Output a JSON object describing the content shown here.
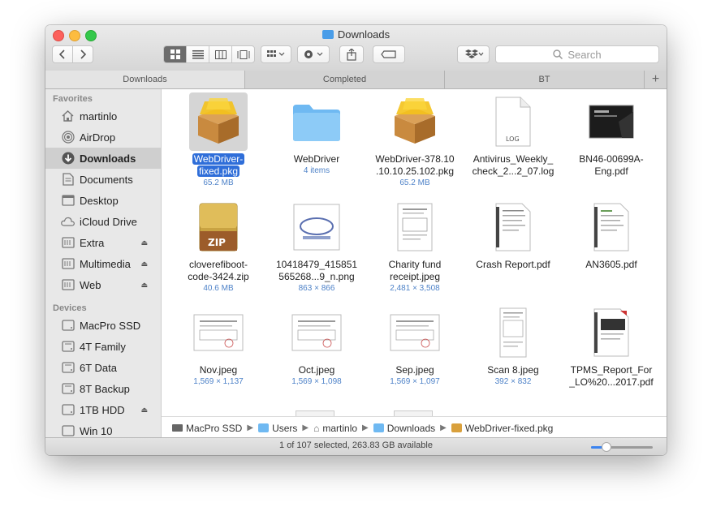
{
  "window": {
    "title": "Downloads"
  },
  "toolbar": {
    "search_placeholder": "Search"
  },
  "tabs": [
    {
      "label": "Downloads"
    },
    {
      "label": "Completed"
    },
    {
      "label": "BT"
    }
  ],
  "sidebar": {
    "favorites_header": "Favorites",
    "favorites": [
      {
        "label": "martinlo"
      },
      {
        "label": "AirDrop"
      },
      {
        "label": "Downloads"
      },
      {
        "label": "Documents"
      },
      {
        "label": "Desktop"
      },
      {
        "label": "iCloud Drive"
      },
      {
        "label": "Extra"
      },
      {
        "label": "Multimedia"
      },
      {
        "label": "Web"
      }
    ],
    "devices_header": "Devices",
    "devices": [
      {
        "label": "MacPro SSD"
      },
      {
        "label": "4T Family"
      },
      {
        "label": "6T Data"
      },
      {
        "label": "8T Backup"
      },
      {
        "label": "1TB HDD"
      },
      {
        "label": "Win 10"
      }
    ]
  },
  "files": [
    {
      "name": "WebDriver-fixed.pkg",
      "line1": "WebDriver-",
      "line2": "fixed.pkg",
      "meta": "65.2 MB"
    },
    {
      "name": "WebDriver",
      "line1": "WebDriver",
      "line2": "",
      "meta": "4 items"
    },
    {
      "name": "WebDriver-378.10.10.10.25.102.pkg",
      "line1": "WebDriver-378.10",
      "line2": ".10.10.25.102.pkg",
      "meta": "65.2 MB"
    },
    {
      "name": "Antivirus_Weekly_check",
      "line1": "Antivirus_Weekly_",
      "line2": "check_2...2_07.log",
      "meta": ""
    },
    {
      "name": "BN46-00699A-Eng.pdf",
      "line1": "BN46-00699A-",
      "line2": "Eng.pdf",
      "meta": ""
    },
    {
      "name": "cloverefiboot-code-3424.zip",
      "line1": "cloverefiboot-",
      "line2": "code-3424.zip",
      "meta": "40.6 MB"
    },
    {
      "name": "10418479_415851565268...9_n.png",
      "line1": "10418479_415851",
      "line2": "565268...9_n.png",
      "meta": "863 × 866"
    },
    {
      "name": "Charity fund receipt.jpeg",
      "line1": "Charity fund",
      "line2": "receipt.jpeg",
      "meta": "2,481 × 3,508"
    },
    {
      "name": "Crash Report.pdf",
      "line1": "Crash Report.pdf",
      "line2": "",
      "meta": ""
    },
    {
      "name": "AN3605.pdf",
      "line1": "AN3605.pdf",
      "line2": "",
      "meta": ""
    },
    {
      "name": "Nov.jpeg",
      "line1": "Nov.jpeg",
      "line2": "",
      "meta": "1,569 × 1,137"
    },
    {
      "name": "Oct.jpeg",
      "line1": "Oct.jpeg",
      "line2": "",
      "meta": "1,569 × 1,098"
    },
    {
      "name": "Sep.jpeg",
      "line1": "Sep.jpeg",
      "line2": "",
      "meta": "1,569 × 1,097"
    },
    {
      "name": "Scan 8.jpeg",
      "line1": "Scan 8.jpeg",
      "line2": "",
      "meta": "392 × 832"
    },
    {
      "name": "TPMS_Report_For_LO%20...2017.pdf",
      "line1": "TPMS_Report_For",
      "line2": "_LO%20...2017.pdf",
      "meta": ""
    }
  ],
  "pathbar": [
    {
      "label": "MacPro SSD"
    },
    {
      "label": "Users"
    },
    {
      "label": "martinlo"
    },
    {
      "label": "Downloads"
    },
    {
      "label": "WebDriver-fixed.pkg"
    }
  ],
  "status": {
    "text": "1 of 107 selected, 263.83 GB available"
  },
  "zoom_slider": {
    "value": 0.25
  }
}
